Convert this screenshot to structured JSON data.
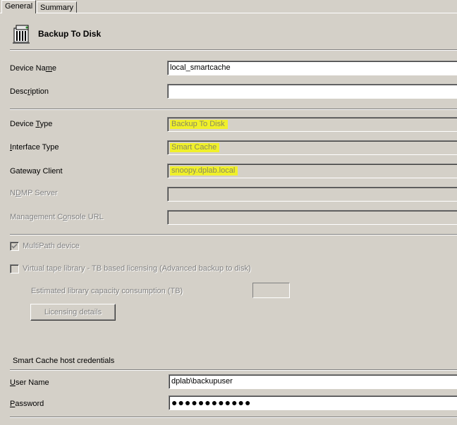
{
  "tabs": [
    {
      "label": "General",
      "active": true
    },
    {
      "label": "Summary",
      "active": false
    }
  ],
  "header": {
    "title": "Backup To Disk",
    "icon": "disk-device-icon"
  },
  "fields": {
    "device_name": {
      "label": "Device Name",
      "value": "local_smartcache"
    },
    "description": {
      "label": "Description",
      "value": ""
    },
    "device_type": {
      "label": "Device Type",
      "value": "Backup To Disk"
    },
    "interface_type": {
      "label": "Interface Type",
      "value": "Smart Cache"
    },
    "gateway_client": {
      "label": "Gateway Client",
      "value": "snoopy.dplab.local"
    },
    "ndmp_server": {
      "label": "NDMP Server",
      "value": ""
    },
    "management_console_url": {
      "label": "Management Console URL",
      "value": ""
    }
  },
  "options": {
    "multipath": {
      "label": "MultiPath device",
      "checked": true
    },
    "vtl": {
      "label": "Virtual tape library - TB based licensing (Advanced backup to disk)",
      "checked": false
    },
    "capacity_label": "Estimated library capacity consumption (TB)",
    "capacity_value": "",
    "licensing_button": "Licensing details"
  },
  "credentials": {
    "section_title": "Smart Cache host credentials",
    "user_name": {
      "label": "User Name",
      "value": "dplab\\backupuser"
    },
    "password": {
      "label": "Password",
      "value": "●●●●●●●●●●●●"
    }
  },
  "colors": {
    "highlight": "#f0f02a",
    "background": "#d4d0c8"
  }
}
